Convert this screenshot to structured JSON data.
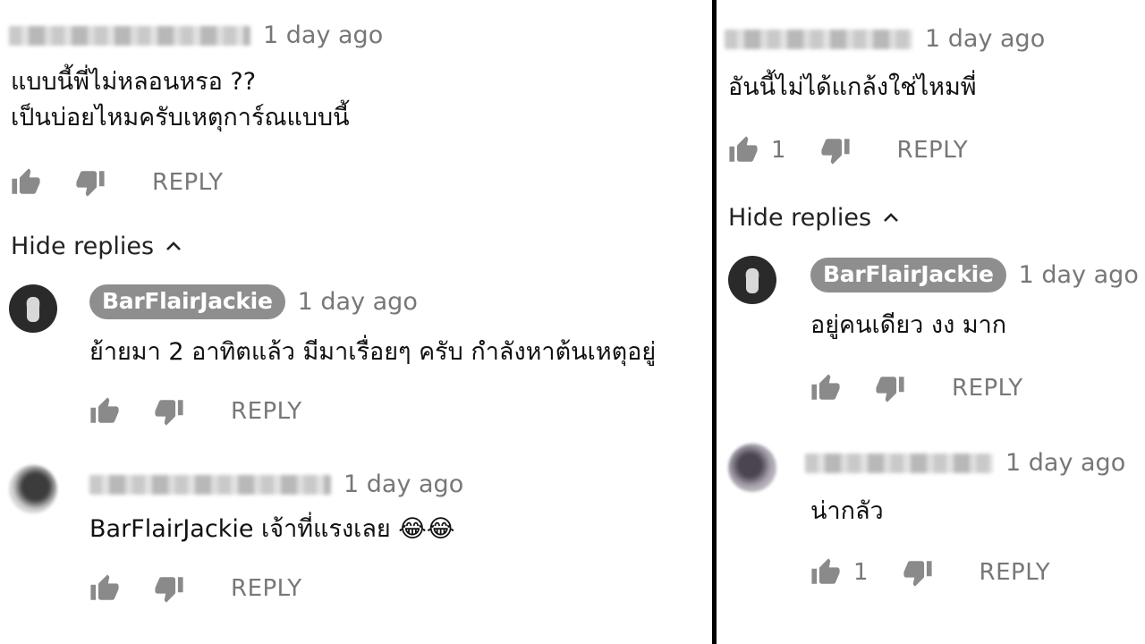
{
  "left": {
    "top_comment": {
      "time": "1 day ago",
      "lines": [
        "แบบนี้พี่ไม่หลอนหรอ ??",
        "เป็นบ่อยไหมครับเหตุการ์ณแบบนี้"
      ],
      "reply": "REPLY"
    },
    "hide_replies": "Hide replies",
    "replies": [
      {
        "author": "BarFlairJackie",
        "time": "1 day ago",
        "text": "ย้ายมา 2 อาทิตแล้ว มีมาเรื่อยๆ ครับ กำลังหาต้นเหตุอยู่",
        "reply": "REPLY"
      },
      {
        "time": "1 day ago",
        "text": "BarFlairJackie เจ้าที่แรงเลย 😂😂",
        "reply": "REPLY"
      }
    ]
  },
  "right": {
    "top_comment": {
      "time": "1 day ago",
      "text": "อันนี้ไม่ได้แกล้งใช่ไหมพี่",
      "likes": "1",
      "reply": "REPLY"
    },
    "hide_replies": "Hide replies",
    "replies": [
      {
        "author": "BarFlairJackie",
        "time": "1 day ago",
        "text": "อยู่คนเดียว งง มาก",
        "reply": "REPLY"
      },
      {
        "time": "1 day ago",
        "text": "น่ากลัว",
        "likes": "1",
        "reply": "REPLY"
      }
    ]
  },
  "icons": {
    "like": "thumbs-up-icon",
    "dislike": "thumbs-down-icon",
    "toggle": "chevron-up-icon"
  },
  "colors": {
    "chip": "#8e8e8e",
    "muted": "#777777",
    "divider": "#000000"
  }
}
